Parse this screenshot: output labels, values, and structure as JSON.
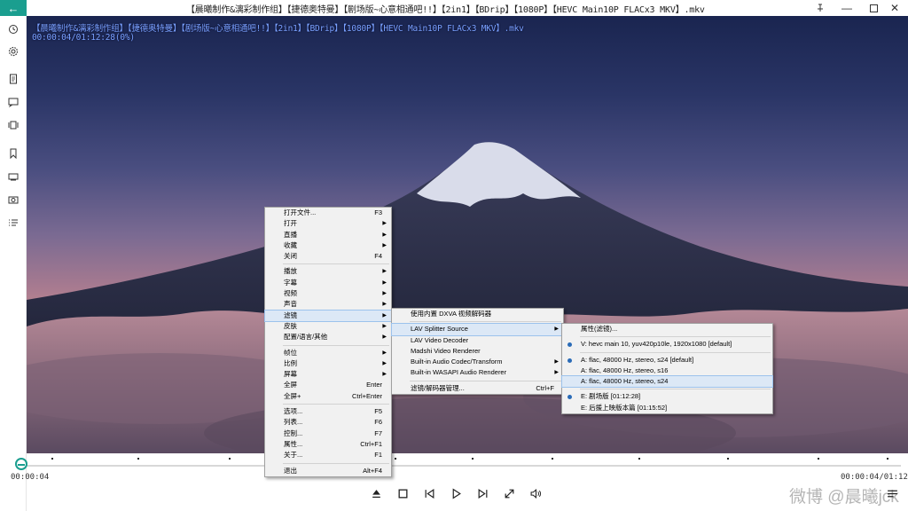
{
  "window": {
    "title": "【晨曦制作&漓彩制作组】【捷德奥特曼】【剧场版~心意相通吧!!】【2in1】【BDrip】【1080P】【HEVC Main10P FLACx3 MKV】.mkv",
    "pin_icon": "pin-icon",
    "minimize_icon": "minimize-icon",
    "maximize_icon": "maximize-icon",
    "close_icon": "close-icon"
  },
  "sidebar": {
    "back_icon": "arrow-left-icon",
    "accent_color": "#1a9e8f",
    "items": [
      {
        "name": "sidebar-history",
        "icon": "history-icon"
      },
      {
        "name": "sidebar-settings",
        "icon": "gear-icon"
      },
      {
        "name": "sidebar-playlist",
        "icon": "document-icon"
      },
      {
        "name": "sidebar-subtitle",
        "icon": "chat-icon"
      },
      {
        "name": "sidebar-chapters",
        "icon": "frames-icon"
      },
      {
        "name": "sidebar-bookmark",
        "icon": "bookmark-icon"
      },
      {
        "name": "sidebar-screen",
        "icon": "monitor-icon"
      },
      {
        "name": "sidebar-screenshot",
        "icon": "camera-icon"
      },
      {
        "name": "sidebar-list",
        "icon": "list-icon"
      }
    ]
  },
  "video": {
    "osd_line1": "【晨曦制作&漓彩制作组】【捷德奥特曼】【剧场版~心意相通吧!!】【2in1】【BDrip】【1080P】【HEVC Main10P FLACx3 MKV】.mkv",
    "osd_line2": "00:00:04/01:12:28(0%)"
  },
  "player": {
    "current_time": "00:00:04",
    "total_time": "01:12:28",
    "time_display": "00:00:04/01:12:28",
    "progress_fraction": 0.001,
    "controls": [
      "eject-icon",
      "stop-icon",
      "previous-icon",
      "play-icon",
      "next-icon",
      "fullscreen-icon",
      "volume-icon"
    ],
    "playlist_icon": "playlist-icon",
    "watermark": "微博 @晨曦jck"
  },
  "main_menu": {
    "groups": [
      [
        {
          "label": "打开文件...",
          "shortcut": "F3",
          "submenu": false
        },
        {
          "label": "打开",
          "shortcut": "",
          "submenu": true
        },
        {
          "label": "直播",
          "shortcut": "",
          "submenu": true
        },
        {
          "label": "收藏",
          "shortcut": "",
          "submenu": true
        },
        {
          "label": "关闭",
          "shortcut": "F4",
          "submenu": false
        }
      ],
      [
        {
          "label": "播放",
          "shortcut": "",
          "submenu": true
        },
        {
          "label": "字幕",
          "shortcut": "",
          "submenu": true
        },
        {
          "label": "视频",
          "shortcut": "",
          "submenu": true
        },
        {
          "label": "声音",
          "shortcut": "",
          "submenu": true
        },
        {
          "label": "滤镜",
          "shortcut": "",
          "submenu": true,
          "highlight": true
        },
        {
          "label": "皮肤",
          "shortcut": "",
          "submenu": true
        },
        {
          "label": "配置/语言/其他",
          "shortcut": "",
          "submenu": true
        }
      ],
      [
        {
          "label": "帧位",
          "shortcut": "",
          "submenu": true
        },
        {
          "label": "比例",
          "shortcut": "",
          "submenu": true
        },
        {
          "label": "屏幕",
          "shortcut": "",
          "submenu": true
        },
        {
          "label": "全屏",
          "shortcut": "Enter",
          "submenu": false
        },
        {
          "label": "全屏+",
          "shortcut": "Ctrl+Enter",
          "submenu": false
        }
      ],
      [
        {
          "label": "选项...",
          "shortcut": "F5",
          "submenu": false
        },
        {
          "label": "列表...",
          "shortcut": "F6",
          "submenu": false
        },
        {
          "label": "控制...",
          "shortcut": "F7",
          "submenu": false
        },
        {
          "label": "属性...",
          "shortcut": "Ctrl+F1",
          "submenu": false
        },
        {
          "label": "关于...",
          "shortcut": "F1",
          "submenu": false
        }
      ],
      [
        {
          "label": "退出",
          "shortcut": "Alt+F4",
          "submenu": false
        }
      ]
    ]
  },
  "filter_menu": {
    "groups": [
      [
        {
          "label": "使用内置 DXVA 视频解码器",
          "shortcut": "",
          "submenu": false
        }
      ],
      [
        {
          "label": "LAV Splitter Source",
          "shortcut": "",
          "submenu": true,
          "highlight": true
        },
        {
          "label": "LAV Video Decoder",
          "shortcut": "",
          "submenu": false
        },
        {
          "label": "Madshi Video Renderer",
          "shortcut": "",
          "submenu": false
        },
        {
          "label": "Built-in Audio Codec/Transform",
          "shortcut": "",
          "submenu": true
        },
        {
          "label": "Built-in WASAPI Audio Renderer",
          "shortcut": "",
          "submenu": true
        }
      ],
      [
        {
          "label": "滤镜/解码器管理...",
          "shortcut": "Ctrl+F",
          "submenu": false
        }
      ]
    ]
  },
  "lav_menu": {
    "groups": [
      [
        {
          "label": "属性(滤镜)...",
          "checked": false
        }
      ],
      [
        {
          "label": "V: hevc main 10, yuv420p10le, 1920x1080 [default]",
          "checked": true
        }
      ],
      [
        {
          "label": "A: flac, 48000 Hz, stereo, s24 [default]",
          "checked": true
        },
        {
          "label": "A: flac, 48000 Hz, stereo, s16",
          "checked": false
        },
        {
          "label": "A: flac, 48000 Hz, stereo, s24",
          "checked": false,
          "highlight": true
        }
      ],
      [
        {
          "label": "E: 剧场版 [01:12:28]",
          "checked": true
        },
        {
          "label": "E: 后援上映版本篇 [01:15:52]",
          "checked": false
        }
      ]
    ]
  }
}
